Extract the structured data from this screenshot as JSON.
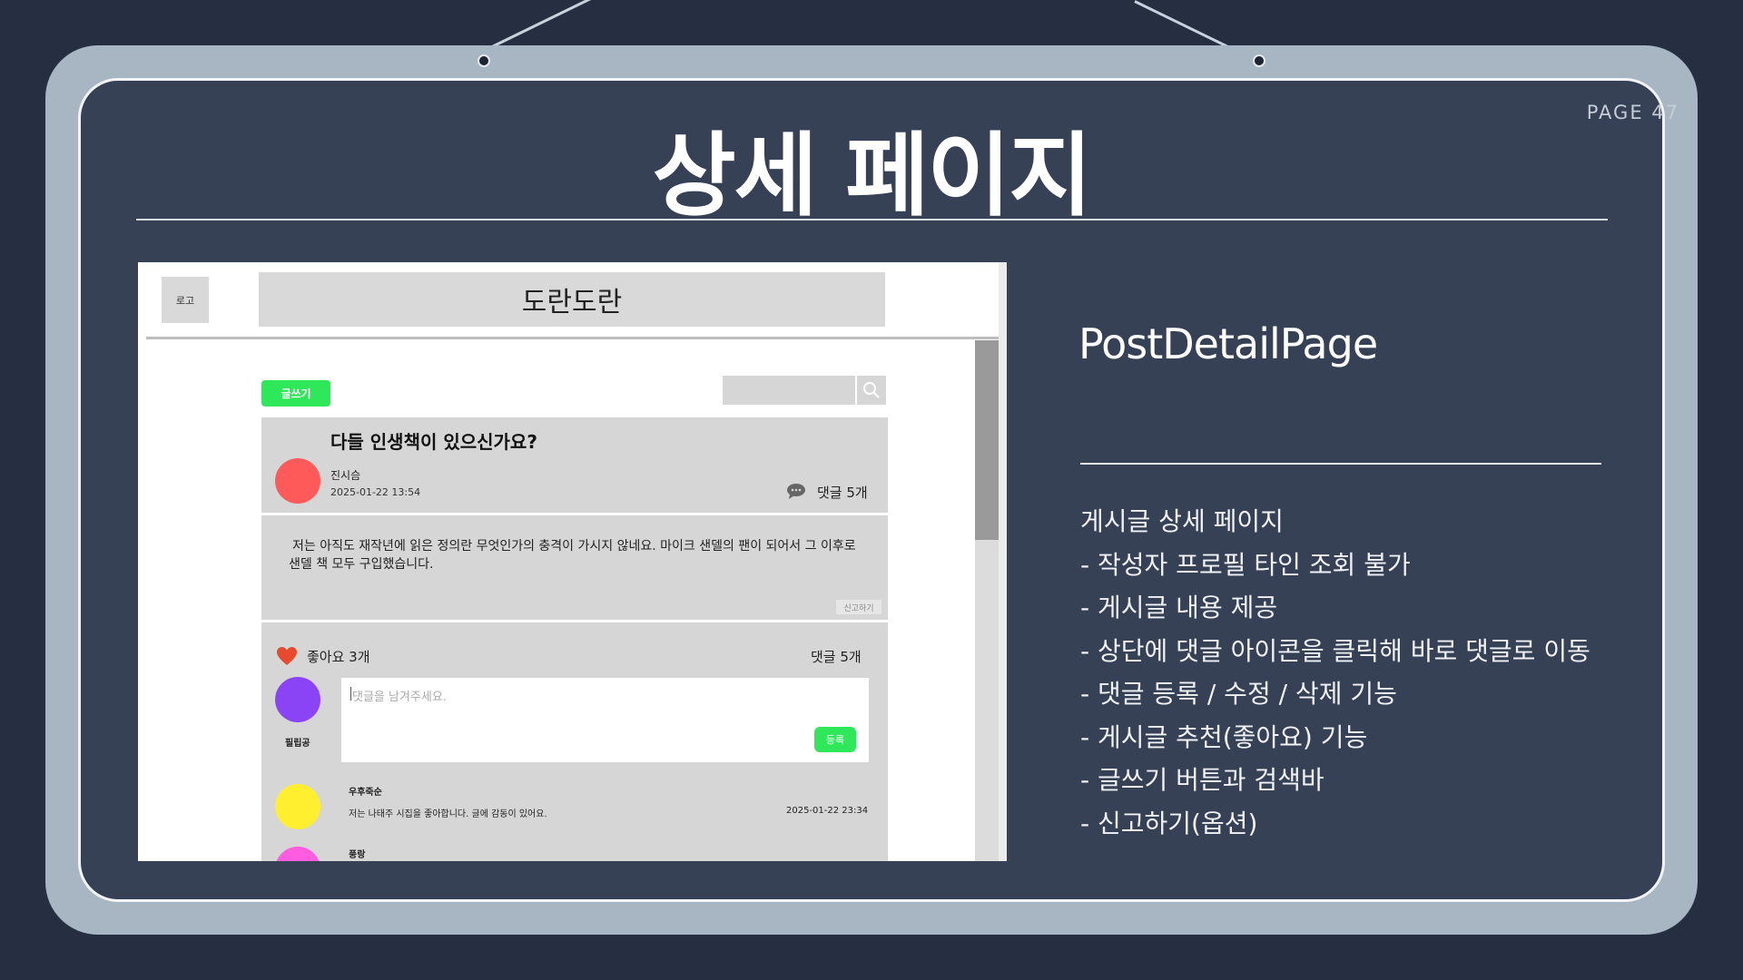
{
  "slide": {
    "title": "상세 페이지",
    "page_label": "PAGE 47",
    "component_name": "PostDetailPage",
    "description": [
      "게시글 상세 페이지",
      "- 작성자 프로필 타인 조회 불가",
      "- 게시글 내용 제공",
      "- 상단에 댓글 아이콘을 클릭해 바로 댓글로 이동",
      "- 댓글 등록 / 수정 / 삭제 기능",
      "- 게시글 추천(좋아요) 기능",
      "- 글쓰기 버튼과 검색바",
      "- 신고하기(옵션)"
    ]
  },
  "mockup": {
    "logo": "로고",
    "site_title": "도란도란",
    "write_button": "글쓰기",
    "post": {
      "title": "다들 인생책이 있으신가요?",
      "author": "진시슴",
      "date": "2025-01-22 13:54",
      "comment_count": "댓글 5개",
      "body": "저는 아직도 재작년에 읽은 정의란 무엇인가의 충격이 가시지 않네요. 마이크 샌델의 팬이 되어서 그 이후로 샌델 책 모두 구입했습니다.",
      "report": "신고하기",
      "likes": "좋아요 3개",
      "comments_label": "댓글 5개"
    },
    "comment_form": {
      "placeholder": "댓글을 남겨주세요.",
      "submit": "등록",
      "my_name": "필립공"
    },
    "comments": [
      {
        "name": "우후죽순",
        "text": "저는 나태주 시집을 좋아합니다. 글에 감동이 있어요.",
        "date": "2025-01-22 23:34"
      },
      {
        "name": "풍랑",
        "text": "",
        "date": ""
      }
    ],
    "colors": {
      "author_avatar": "#ff5a5a",
      "my_avatar": "#8a44f5",
      "comment1_avatar": "#ffef2e",
      "comment2_avatar": "#ff5ce0",
      "heart": "#e84a2e",
      "green": "#2ee85a"
    }
  }
}
